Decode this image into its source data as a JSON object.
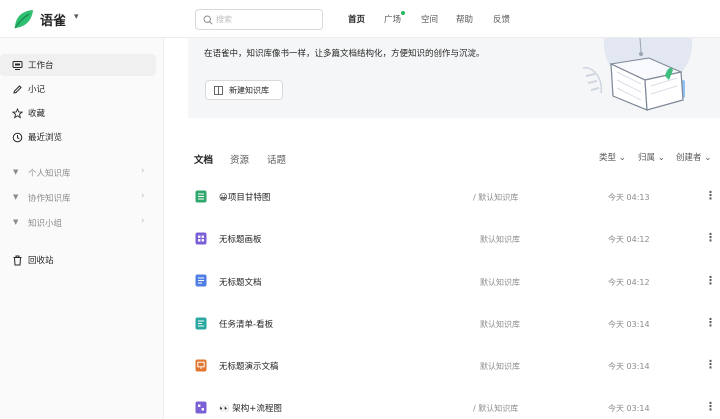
{
  "header": {
    "brand": "语雀",
    "search_placeholder": "搜索",
    "nav": [
      "首页",
      "广场",
      "空间",
      "帮助",
      "反馈"
    ]
  },
  "sidebar": {
    "items": [
      {
        "label": "工作台",
        "icon": "desk-icon"
      },
      {
        "label": "小记",
        "icon": "pen-icon"
      },
      {
        "label": "收藏",
        "icon": "star-icon"
      },
      {
        "label": "最近浏览",
        "icon": "clock-icon"
      }
    ],
    "groups": [
      "个人知识库",
      "协作知识库",
      "知识小组"
    ],
    "trash": "回收站"
  },
  "banner": {
    "text": "在语雀中，知识库像书一样，让多篇文档结构化，方便知识的创作与沉淀。",
    "button": "新建知识库"
  },
  "tabs": [
    "文档",
    "资源",
    "话题"
  ],
  "filters": [
    "类型",
    "归属",
    "创建者"
  ],
  "docs": [
    {
      "title": "😀项目甘特图",
      "lib": "/ 默认知识库",
      "time": "今天 04:13",
      "color": "#2fa66b"
    },
    {
      "title": "无标题画板",
      "lib": "默认知识库",
      "time": "今天 04:12",
      "color": "#7a5fd6"
    },
    {
      "title": "无标题文档",
      "lib": "默认知识库",
      "time": "今天 04:12",
      "color": "#4f7de3"
    },
    {
      "title": "任务清单-看板",
      "lib": "默认知识库",
      "time": "今天 03:14",
      "color": "#2aa7a0"
    },
    {
      "title": "无标题演示文稿",
      "lib": "默认知识库",
      "time": "今天 03:14",
      "color": "#e0762f"
    },
    {
      "title": "👀 架构+流程图",
      "lib": "/ 默认知识库",
      "time": "今天 03:14",
      "color": "#7a5fd6"
    }
  ]
}
